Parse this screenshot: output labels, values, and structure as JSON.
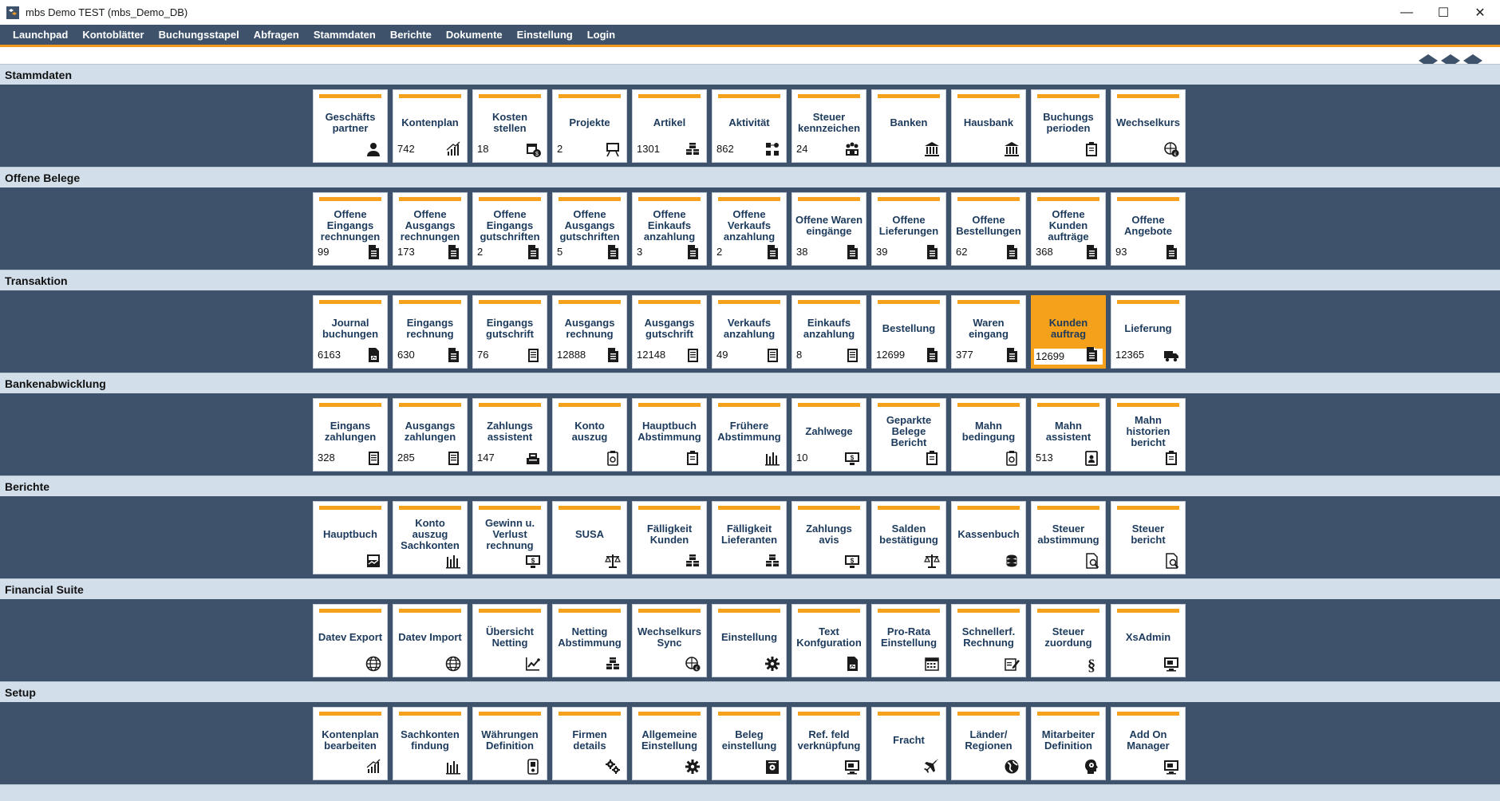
{
  "window": {
    "title": "mbs Demo TEST (mbs_Demo_DB)",
    "controls": {
      "minimize": "—",
      "maximize": "☐",
      "close": "✕"
    }
  },
  "menu": [
    "Launchpad",
    "Kontoblätter",
    "Buchungsstapel",
    "Abfragen",
    "Stammdaten",
    "Berichte",
    "Dokumente",
    "Einstellung",
    "Login"
  ],
  "colors": {
    "menubar": "#3e536b",
    "accent": "#f5a11b",
    "section_header": "#d2dfea",
    "tile_text": "#1c3a5c"
  },
  "sections": [
    {
      "title": "Stammdaten",
      "tiles": [
        {
          "label": "Geschäfts\npartner",
          "count": "",
          "icon": "person-icon"
        },
        {
          "label": "Kontenplan",
          "count": "742",
          "icon": "chart-growth-icon"
        },
        {
          "label": "Kosten\nstellen",
          "count": "18",
          "icon": "calendar-money-icon"
        },
        {
          "label": "Projekte",
          "count": "2",
          "icon": "presentation-icon"
        },
        {
          "label": "Artikel",
          "count": "1301",
          "icon": "boxes-icon"
        },
        {
          "label": "Aktivität",
          "count": "862",
          "icon": "activity-icon"
        },
        {
          "label": "Steuer\nkennzeichen",
          "count": "24",
          "icon": "group-icon"
        },
        {
          "label": "Banken",
          "count": "",
          "icon": "bank-icon"
        },
        {
          "label": "Hausbank",
          "count": "",
          "icon": "bank-icon"
        },
        {
          "label": "Buchungs\nperioden",
          "count": "",
          "icon": "clipboard-icon"
        },
        {
          "label": "Wechselkurs",
          "count": "",
          "icon": "globe-exchange-icon"
        }
      ]
    },
    {
      "title": "Offene Belege",
      "tiles": [
        {
          "label": "Offene\nEingangs\nrechnungen",
          "count": "99",
          "icon": "document-icon"
        },
        {
          "label": "Offene\nAusgangs\nrechnungen",
          "count": "173",
          "icon": "document-icon"
        },
        {
          "label": "Offene\nEingangs\ngutschriften",
          "count": "2",
          "icon": "document-icon"
        },
        {
          "label": "Offene\nAusgangs\ngutschriften",
          "count": "5",
          "icon": "document-icon"
        },
        {
          "label": "Offene\nEinkaufs\nanzahlung",
          "count": "3",
          "icon": "document-icon"
        },
        {
          "label": "Offene\nVerkaufs\nanzahlung",
          "count": "2",
          "icon": "document-icon"
        },
        {
          "label": "Offene Waren\neingänge",
          "count": "38",
          "icon": "document-icon"
        },
        {
          "label": "Offene\nLieferungen",
          "count": "39",
          "icon": "document-icon"
        },
        {
          "label": "Offene\nBestellungen",
          "count": "62",
          "icon": "document-icon"
        },
        {
          "label": "Offene\nKunden\naufträge",
          "count": "368",
          "icon": "document-icon"
        },
        {
          "label": "Offene\nAngebote",
          "count": "93",
          "icon": "document-icon"
        }
      ]
    },
    {
      "title": "Transaktion",
      "tiles": [
        {
          "label": "Journal\nbuchungen",
          "count": "6163",
          "icon": "journal-icon"
        },
        {
          "label": "Eingangs\nrechnung",
          "count": "630",
          "icon": "document-icon"
        },
        {
          "label": "Eingangs\ngutschrift",
          "count": "76",
          "icon": "ledger-icon"
        },
        {
          "label": "Ausgangs\nrechnung",
          "count": "12888",
          "icon": "document-icon"
        },
        {
          "label": "Ausgangs\ngutschrift",
          "count": "12148",
          "icon": "ledger-icon"
        },
        {
          "label": "Verkaufs\nanzahlung",
          "count": "49",
          "icon": "ledger-icon"
        },
        {
          "label": "Einkaufs\nanzahlung",
          "count": "8",
          "icon": "ledger-icon"
        },
        {
          "label": "Bestellung",
          "count": "12699",
          "icon": "document-icon"
        },
        {
          "label": "Waren\neingang",
          "count": "377",
          "icon": "document-icon"
        },
        {
          "label": "Kunden\nauftrag",
          "count": "12699",
          "icon": "document-icon",
          "active": true
        },
        {
          "label": "Lieferung",
          "count": "12365",
          "icon": "truck-icon"
        }
      ]
    },
    {
      "title": "Bankenabwicklung",
      "tiles": [
        {
          "label": "Eingans\nzahlungen",
          "count": "328",
          "icon": "ledger-icon"
        },
        {
          "label": "Ausgangs\nzahlungen",
          "count": "285",
          "icon": "ledger-icon"
        },
        {
          "label": "Zahlungs\nassistent",
          "count": "147",
          "icon": "cash-register-icon"
        },
        {
          "label": "Konto\nauszug",
          "count": "",
          "icon": "statement-icon"
        },
        {
          "label": "Hauptbuch\nAbstimmung",
          "count": "",
          "icon": "clipboard-icon"
        },
        {
          "label": "Frühere\nAbstimmung",
          "count": "",
          "icon": "bars-icon"
        },
        {
          "label": "Zahlwege",
          "count": "10",
          "icon": "money-screen-icon"
        },
        {
          "label": "Geparkte\nBelege\nBericht",
          "count": "",
          "icon": "clipboard-icon"
        },
        {
          "label": "Mahn\nbedingung",
          "count": "",
          "icon": "statement-icon"
        },
        {
          "label": "Mahn\nassistent",
          "count": "513",
          "icon": "badge-icon"
        },
        {
          "label": "Mahn\nhistorien\nbericht",
          "count": "",
          "icon": "clipboard-icon"
        }
      ]
    },
    {
      "title": "Berichte",
      "tiles": [
        {
          "label": "Hauptbuch",
          "count": "",
          "icon": "report-icon"
        },
        {
          "label": "Konto\nauszug\nSachkonten",
          "count": "",
          "icon": "bars-icon"
        },
        {
          "label": "Gewinn u.\nVerlust\nrechnung",
          "count": "",
          "icon": "money-screen-icon"
        },
        {
          "label": "SUSA",
          "count": "",
          "icon": "scale-icon"
        },
        {
          "label": "Fälligkeit\nKunden",
          "count": "",
          "icon": "boxes-icon"
        },
        {
          "label": "Fälligkeit\nLieferanten",
          "count": "",
          "icon": "boxes-icon"
        },
        {
          "label": "Zahlungs\navis",
          "count": "",
          "icon": "money-screen-icon"
        },
        {
          "label": "Salden\nbestätigung",
          "count": "",
          "icon": "scale-icon"
        },
        {
          "label": "Kassenbuch",
          "count": "",
          "icon": "coins-icon"
        },
        {
          "label": "Steuer\nabstimmung",
          "count": "",
          "icon": "tax-report-icon"
        },
        {
          "label": "Steuer\nbericht",
          "count": "",
          "icon": "tax-report-icon"
        }
      ]
    },
    {
      "title": "Financial Suite",
      "tiles": [
        {
          "label": "Datev Export",
          "count": "",
          "icon": "globe-icon"
        },
        {
          "label": "Datev Import",
          "count": "",
          "icon": "globe-icon"
        },
        {
          "label": "Übersicht\nNetting",
          "count": "",
          "icon": "trend-icon"
        },
        {
          "label": "Netting\nAbstimmung",
          "count": "",
          "icon": "boxes-icon"
        },
        {
          "label": "Wechselkurs\nSync",
          "count": "",
          "icon": "globe-exchange-icon"
        },
        {
          "label": "Einstellung",
          "count": "",
          "icon": "gear-icon"
        },
        {
          "label": "Text\nKonfguration",
          "count": "",
          "icon": "journal-icon"
        },
        {
          "label": "Pro-Rata\nEinstellung",
          "count": "",
          "icon": "calendar-icon"
        },
        {
          "label": "Schnellerf.\nRechnung",
          "count": "",
          "icon": "edit-doc-icon"
        },
        {
          "label": "Steuer\nzuordung",
          "count": "",
          "icon": "paragraph-icon"
        },
        {
          "label": "XsAdmin",
          "count": "",
          "icon": "monitor-icon"
        }
      ]
    },
    {
      "title": "Setup",
      "tiles": [
        {
          "label": "Kontenplan\nbearbeiten",
          "count": "",
          "icon": "chart-growth-icon"
        },
        {
          "label": "Sachkonten\nfindung",
          "count": "",
          "icon": "bars-icon"
        },
        {
          "label": "Währungen\nDefinition",
          "count": "",
          "icon": "device-icon"
        },
        {
          "label": "Firmen\ndetails",
          "count": "",
          "icon": "gears-icon"
        },
        {
          "label": "Allgemeine\nEinstellung",
          "count": "",
          "icon": "gear-icon"
        },
        {
          "label": "Beleg\neinstellung",
          "count": "",
          "icon": "doc-gear-icon"
        },
        {
          "label": "Ref. feld\nverknüpfung",
          "count": "",
          "icon": "monitor-icon"
        },
        {
          "label": "Fracht",
          "count": "",
          "icon": "plane-icon"
        },
        {
          "label": "Länder/\nRegionen",
          "count": "",
          "icon": "earth-icon"
        },
        {
          "label": "Mitarbeiter\nDefinition",
          "count": "",
          "icon": "head-gear-icon"
        },
        {
          "label": "Add On\nManager",
          "count": "",
          "icon": "monitor-icon"
        }
      ]
    }
  ]
}
